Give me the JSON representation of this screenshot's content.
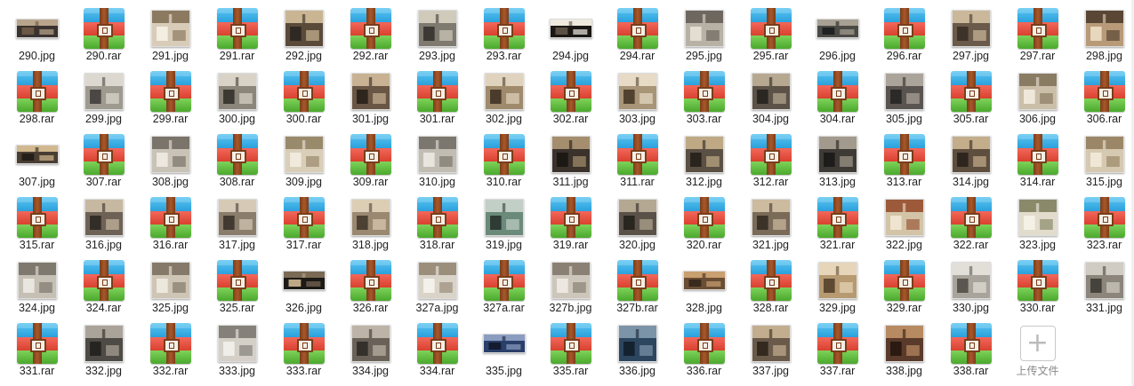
{
  "files": [
    {
      "name": "290.jpg",
      "type": "jpg",
      "colors": [
        "#3a3330",
        "#b9a58c",
        "#6b5845"
      ],
      "aspect": "wide"
    },
    {
      "name": "290.rar",
      "type": "rar"
    },
    {
      "name": "291.jpg",
      "type": "jpg",
      "colors": [
        "#d8ccb8",
        "#8c7a60",
        "#f3ede2"
      ],
      "aspect": "normal"
    },
    {
      "name": "291.rar",
      "type": "rar"
    },
    {
      "name": "292.jpg",
      "type": "jpg",
      "colors": [
        "#5a4a3a",
        "#c9b592",
        "#2f2924"
      ],
      "aspect": "normal"
    },
    {
      "name": "292.rar",
      "type": "rar"
    },
    {
      "name": "293.jpg",
      "type": "jpg",
      "colors": [
        "#7f7a70",
        "#d0cabb",
        "#3c3934"
      ],
      "aspect": "normal"
    },
    {
      "name": "293.rar",
      "type": "rar"
    },
    {
      "name": "294.jpg",
      "type": "jpg",
      "colors": [
        "#1a1714",
        "#efe9de",
        "#5c5045"
      ],
      "aspect": "wide"
    },
    {
      "name": "294.rar",
      "type": "rar"
    },
    {
      "name": "295.jpg",
      "type": "jpg",
      "colors": [
        "#b8b2a6",
        "#6d6760",
        "#e4ded2"
      ],
      "aspect": "normal"
    },
    {
      "name": "295.rar",
      "type": "rar"
    },
    {
      "name": "296.jpg",
      "type": "jpg",
      "colors": [
        "#4c4a46",
        "#a7a093",
        "#202122"
      ],
      "aspect": "wide"
    },
    {
      "name": "296.rar",
      "type": "rar"
    },
    {
      "name": "297.jpg",
      "type": "jpg",
      "colors": [
        "#6a5a4a",
        "#cbb89a",
        "#3e332a"
      ],
      "aspect": "normal"
    },
    {
      "name": "297.rar",
      "type": "rar"
    },
    {
      "name": "298.jpg",
      "type": "jpg",
      "colors": [
        "#b89a78",
        "#5a4634",
        "#e6d7bd"
      ],
      "aspect": "normal"
    },
    {
      "name": "298.rar",
      "type": "rar"
    },
    {
      "name": "299.jpg",
      "type": "jpg",
      "colors": [
        "#9f9a90",
        "#dcd8cf",
        "#4a4744"
      ],
      "aspect": "normal"
    },
    {
      "name": "299.rar",
      "type": "rar"
    },
    {
      "name": "300.jpg",
      "type": "jpg",
      "colors": [
        "#8c857a",
        "#d9d3c7",
        "#3c3832"
      ],
      "aspect": "normal"
    },
    {
      "name": "300.rar",
      "type": "rar"
    },
    {
      "name": "301.jpg",
      "type": "jpg",
      "colors": [
        "#6a5644",
        "#c8b293",
        "#2e251d"
      ],
      "aspect": "normal"
    },
    {
      "name": "301.rar",
      "type": "rar"
    },
    {
      "name": "302.jpg",
      "type": "jpg",
      "colors": [
        "#a08a6c",
        "#e0d3bd",
        "#4a3b2c"
      ],
      "aspect": "normal"
    },
    {
      "name": "302.rar",
      "type": "rar"
    },
    {
      "name": "303.jpg",
      "type": "jpg",
      "colors": [
        "#a89477",
        "#e7dbc6",
        "#51412f"
      ],
      "aspect": "normal"
    },
    {
      "name": "303.rar",
      "type": "rar"
    },
    {
      "name": "304.jpg",
      "type": "jpg",
      "colors": [
        "#5c5247",
        "#b7a891",
        "#2a2622"
      ],
      "aspect": "normal"
    },
    {
      "name": "304.rar",
      "type": "rar"
    },
    {
      "name": "305.jpg",
      "type": "jpg",
      "colors": [
        "#5a5450",
        "#aba49a",
        "#2c2a28"
      ],
      "aspect": "normal"
    },
    {
      "name": "305.rar",
      "type": "rar"
    },
    {
      "name": "306.jpg",
      "type": "jpg",
      "colors": [
        "#cbbfa9",
        "#8a7b63",
        "#efe8da"
      ],
      "aspect": "normal"
    },
    {
      "name": "306.rar",
      "type": "rar"
    },
    {
      "name": "307.jpg",
      "type": "jpg",
      "colors": [
        "#4a3e33",
        "#d2b88e",
        "#251f1a"
      ],
      "aspect": "wide"
    },
    {
      "name": "307.rar",
      "type": "rar"
    },
    {
      "name": "308.jpg",
      "type": "jpg",
      "colors": [
        "#c9c2b6",
        "#7b746a",
        "#ece7df"
      ],
      "aspect": "normal"
    },
    {
      "name": "308.rar",
      "type": "rar"
    },
    {
      "name": "309.jpg",
      "type": "jpg",
      "colors": [
        "#d9ceb8",
        "#9a8a6c",
        "#f1eadc"
      ],
      "aspect": "normal"
    },
    {
      "name": "309.rar",
      "type": "rar"
    },
    {
      "name": "310.jpg",
      "type": "jpg",
      "colors": [
        "#c2bdb3",
        "#7c776e",
        "#e8e5de"
      ],
      "aspect": "normal"
    },
    {
      "name": "310.rar",
      "type": "rar"
    },
    {
      "name": "311.jpg",
      "type": "jpg",
      "colors": [
        "#3a322b",
        "#a58e6e",
        "#1c1814"
      ],
      "aspect": "normal"
    },
    {
      "name": "311.rar",
      "type": "rar"
    },
    {
      "name": "312.jpg",
      "type": "jpg",
      "colors": [
        "#5b5044",
        "#bfa985",
        "#2a241e"
      ],
      "aspect": "normal"
    },
    {
      "name": "312.rar",
      "type": "rar"
    },
    {
      "name": "313.jpg",
      "type": "jpg",
      "colors": [
        "#3e3a36",
        "#a29a8c",
        "#1e1c1a"
      ],
      "aspect": "normal"
    },
    {
      "name": "313.rar",
      "type": "rar"
    },
    {
      "name": "314.jpg",
      "type": "jpg",
      "colors": [
        "#5e4e3e",
        "#c3ad8b",
        "#2e261e"
      ],
      "aspect": "normal"
    },
    {
      "name": "314.rar",
      "type": "rar"
    },
    {
      "name": "315.jpg",
      "type": "jpg",
      "colors": [
        "#d6c9b1",
        "#9b8767",
        "#f0e7d6"
      ],
      "aspect": "normal"
    },
    {
      "name": "315.rar",
      "type": "rar"
    },
    {
      "name": "316.jpg",
      "type": "jpg",
      "colors": [
        "#6e6256",
        "#c7b8a1",
        "#332d27"
      ],
      "aspect": "normal"
    },
    {
      "name": "316.rar",
      "type": "rar"
    },
    {
      "name": "317.jpg",
      "type": "jpg",
      "colors": [
        "#8b7d6c",
        "#d6cab6",
        "#423a31"
      ],
      "aspect": "normal"
    },
    {
      "name": "317.rar",
      "type": "rar"
    },
    {
      "name": "318.jpg",
      "type": "jpg",
      "colors": [
        "#9a8870",
        "#dccdb5",
        "#4c4133"
      ],
      "aspect": "normal"
    },
    {
      "name": "318.rar",
      "type": "rar"
    },
    {
      "name": "319.jpg",
      "type": "jpg",
      "colors": [
        "#6a8a7a",
        "#c2cfc6",
        "#2f3b35"
      ],
      "aspect": "normal"
    },
    {
      "name": "319.rar",
      "type": "rar"
    },
    {
      "name": "320.jpg",
      "type": "jpg",
      "colors": [
        "#5a5248",
        "#b4a892",
        "#29251f"
      ],
      "aspect": "normal"
    },
    {
      "name": "320.rar",
      "type": "rar"
    },
    {
      "name": "321.jpg",
      "type": "jpg",
      "colors": [
        "#7a6a58",
        "#cdbb9f",
        "#3b3228"
      ],
      "aspect": "normal"
    },
    {
      "name": "321.rar",
      "type": "rar"
    },
    {
      "name": "322.jpg",
      "type": "jpg",
      "colors": [
        "#d3c4a8",
        "#9c5a3a",
        "#efe4cf"
      ],
      "aspect": "normal"
    },
    {
      "name": "322.rar",
      "type": "rar"
    },
    {
      "name": "323.jpg",
      "type": "jpg",
      "colors": [
        "#e2dccd",
        "#8a8a6a",
        "#f5f1e6"
      ],
      "aspect": "normal"
    },
    {
      "name": "323.rar",
      "type": "rar"
    },
    {
      "name": "324.jpg",
      "type": "jpg",
      "colors": [
        "#c5bfb4",
        "#7e786f",
        "#e9e6df"
      ],
      "aspect": "normal"
    },
    {
      "name": "324.rar",
      "type": "rar"
    },
    {
      "name": "325.jpg",
      "type": "jpg",
      "colors": [
        "#cfc5b4",
        "#857a69",
        "#ede8de"
      ],
      "aspect": "normal"
    },
    {
      "name": "325.rar",
      "type": "rar"
    },
    {
      "name": "326.jpg",
      "type": "jpg",
      "colors": [
        "#1c1916",
        "#7a6a55",
        "#bda886"
      ],
      "aspect": "wide"
    },
    {
      "name": "326.rar",
      "type": "rar"
    },
    {
      "name": "327a.jpg",
      "type": "jpg",
      "colors": [
        "#d9d3c8",
        "#9b8f7c",
        "#f4f1ea"
      ],
      "aspect": "normal"
    },
    {
      "name": "327a.rar",
      "type": "rar"
    },
    {
      "name": "327b.jpg",
      "type": "jpg",
      "colors": [
        "#cdc6ba",
        "#8a8174",
        "#ece8e1"
      ],
      "aspect": "normal"
    },
    {
      "name": "327b.rar",
      "type": "rar"
    },
    {
      "name": "328.jpg",
      "type": "jpg",
      "colors": [
        "#6a4e34",
        "#c9a070",
        "#3a2a1c"
      ],
      "aspect": "wide"
    },
    {
      "name": "328.rar",
      "type": "rar"
    },
    {
      "name": "329.jpg",
      "type": "jpg",
      "colors": [
        "#b79a72",
        "#e6d5b8",
        "#5e4a32"
      ],
      "aspect": "normal"
    },
    {
      "name": "329.rar",
      "type": "rar"
    },
    {
      "name": "330.jpg",
      "type": "jpg",
      "colors": [
        "#a9a49b",
        "#e2dfd9",
        "#5a5650"
      ],
      "aspect": "normal"
    },
    {
      "name": "330.rar",
      "type": "rar"
    },
    {
      "name": "331.jpg",
      "type": "jpg",
      "colors": [
        "#8b857b",
        "#d0ccc3",
        "#46423c"
      ],
      "aspect": "normal"
    },
    {
      "name": "331.rar",
      "type": "rar"
    },
    {
      "name": "332.jpg",
      "type": "jpg",
      "colors": [
        "#4e4a45",
        "#aaa399",
        "#262421"
      ],
      "aspect": "normal"
    },
    {
      "name": "332.rar",
      "type": "rar"
    },
    {
      "name": "333.jpg",
      "type": "jpg",
      "colors": [
        "#d4d0c8",
        "#85817a",
        "#f0eee9"
      ],
      "aspect": "normal"
    },
    {
      "name": "333.rar",
      "type": "rar"
    },
    {
      "name": "334.jpg",
      "type": "jpg",
      "colors": [
        "#6a6158",
        "#bdb3a6",
        "#34302b"
      ],
      "aspect": "normal"
    },
    {
      "name": "334.rar",
      "type": "rar"
    },
    {
      "name": "335.jpg",
      "type": "jpg",
      "colors": [
        "#2a3f6a",
        "#8a9cc0",
        "#141c30"
      ],
      "aspect": "wide"
    },
    {
      "name": "335.rar",
      "type": "rar"
    },
    {
      "name": "336.jpg",
      "type": "jpg",
      "colors": [
        "#2c4660",
        "#7c94a8",
        "#142230"
      ],
      "aspect": "normal"
    },
    {
      "name": "336.rar",
      "type": "rar"
    },
    {
      "name": "337.jpg",
      "type": "jpg",
      "colors": [
        "#6a5a4a",
        "#c2ad8e",
        "#33291f"
      ],
      "aspect": "normal"
    },
    {
      "name": "337.rar",
      "type": "rar"
    },
    {
      "name": "338.jpg",
      "type": "jpg",
      "colors": [
        "#5a3a2a",
        "#b88a62",
        "#2a1a12"
      ],
      "aspect": "normal"
    },
    {
      "name": "338.rar",
      "type": "rar"
    }
  ],
  "upload": {
    "label": "上传文件",
    "icon": "plus-icon"
  }
}
